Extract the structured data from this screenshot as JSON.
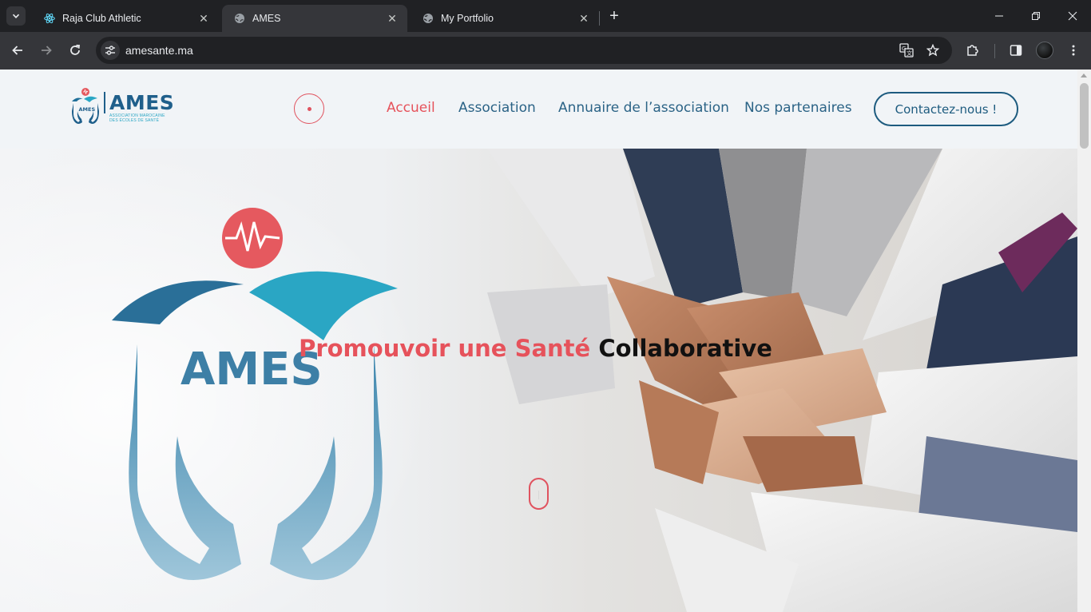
{
  "browser": {
    "tabs": [
      {
        "title": "Raja Club Athletic",
        "icon": "react-icon",
        "active": false
      },
      {
        "title": "AMES",
        "icon": "globe-icon",
        "active": true
      },
      {
        "title": "My Portfolio",
        "icon": "globe-icon",
        "active": false
      }
    ],
    "url": "amesante.ma"
  },
  "site": {
    "logo": {
      "word": "AMES",
      "subtitle_line1": "Association Marocaine",
      "subtitle_line2": "des Écoles de Santé"
    },
    "nav": [
      {
        "label": "Accueil",
        "active": true
      },
      {
        "label": "Association",
        "active": false
      },
      {
        "label": "Annuaire de l’association",
        "active": false
      },
      {
        "label": "Nos partenaires",
        "active": false
      }
    ],
    "cta_label": "Contactez-nous !",
    "hero": {
      "title_accent": "Promouvoir une Santé",
      "title_dark": "Collaborative",
      "logo_word": "AMES"
    }
  },
  "colors": {
    "accent": "#e6525b",
    "primary": "#1f5f8b",
    "teal": "#2aa6c4",
    "header_bg": "#f1f4f7"
  }
}
